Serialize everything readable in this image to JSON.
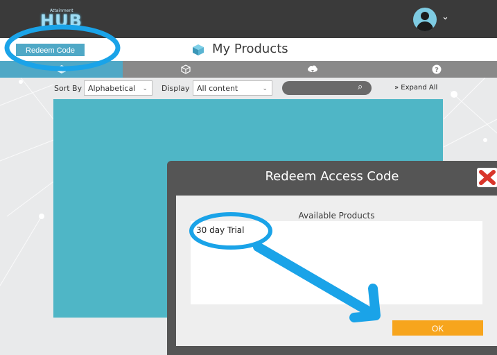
{
  "header": {
    "logo_text": "HUB",
    "logo_small": "Attainment",
    "avatar_icon": "user-avatar-icon",
    "account_menu_icon": "chevron-down-icon"
  },
  "subheader": {
    "redeem_button": "Redeem Code",
    "title": "My Products",
    "title_icon": "cube-icon"
  },
  "tabs": [
    {
      "icon": "products-tab-icon",
      "active": true
    },
    {
      "icon": "cube-outline-icon",
      "active": false
    },
    {
      "icon": "cloud-download-icon",
      "active": false
    },
    {
      "icon": "help-icon",
      "active": false
    }
  ],
  "filters": {
    "sort_label": "Sort By",
    "sort_value": "Alphabetical",
    "display_label": "Display",
    "display_value": "All content",
    "search_placeholder": "",
    "expand_all": "» Expand All"
  },
  "dialog": {
    "title": "Redeem Access Code",
    "available_label": "Available Products",
    "products": [
      "30 day Trial"
    ],
    "ok_button": "OK",
    "close_icon": "close-icon"
  },
  "colors": {
    "accent": "#4fa8c6",
    "panel": "#4fb6c6",
    "ok": "#f7a51d",
    "annotation": "#1aa3e8"
  }
}
